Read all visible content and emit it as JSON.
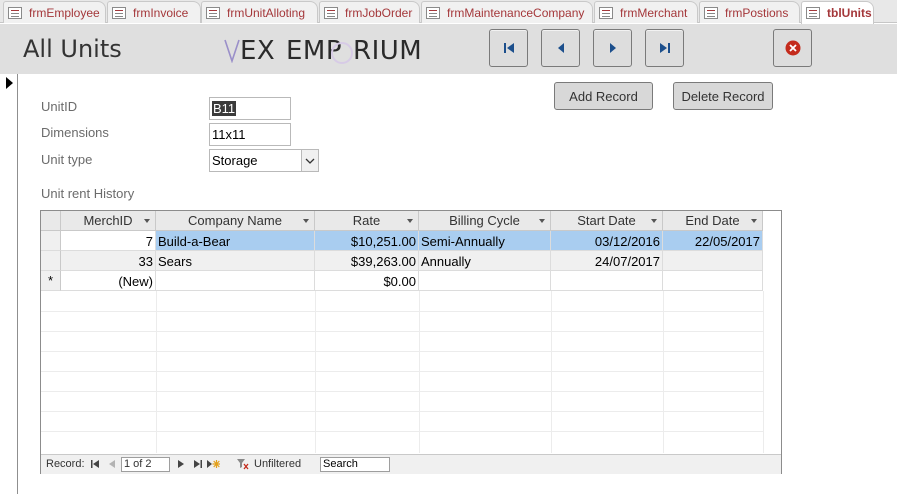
{
  "tabs": [
    {
      "label": "frmEmployee",
      "active": false
    },
    {
      "label": "frmInvoice",
      "active": false
    },
    {
      "label": "frmUnitAlloting",
      "active": false
    },
    {
      "label": "frmJobOrder",
      "active": false
    },
    {
      "label": "frmMaintenanceCompany",
      "active": false
    },
    {
      "label": "frmMerchant",
      "active": false
    },
    {
      "label": "frmPostions",
      "active": false
    },
    {
      "label": "tblUnits",
      "active": true
    }
  ],
  "header": {
    "title": "All Units",
    "logo": {
      "part1": "EX",
      "part2": "EMP",
      "part3": "RIUM"
    }
  },
  "nav_buttons": {
    "first": "first-record-icon",
    "previous": "previous-record-icon",
    "next": "next-record-icon",
    "last": "last-record-icon",
    "close": "close-icon"
  },
  "buttons": {
    "add_record": "Add Record",
    "delete_record": "Delete Record"
  },
  "fields": {
    "unitid": {
      "label": "UnitID",
      "value": "B11"
    },
    "dimensions": {
      "label": "Dimensions",
      "value": "11x11"
    },
    "unit_type": {
      "label": "Unit type",
      "value": "Storage"
    }
  },
  "subform": {
    "label": "Unit rent History",
    "columns": [
      "MerchID",
      "Company Name",
      "Rate",
      "Billing Cycle",
      "Start Date",
      "End Date"
    ],
    "rows": [
      {
        "merch_id": "7",
        "company": "Build-a-Bear",
        "rate": "$10,251.00",
        "billing": "Semi-Annually",
        "start": "03/12/2016",
        "end": "22/05/2017"
      },
      {
        "merch_id": "33",
        "company": "Sears",
        "rate": "$39,263.00",
        "billing": "Annually",
        "start": "24/07/2017",
        "end": ""
      }
    ],
    "new_row": {
      "marker": "*",
      "merch_id": "(New)",
      "rate": "$0.00"
    },
    "navigation": {
      "record_label": "Record:",
      "position": "1 of 2",
      "filter": "Unfiltered",
      "search": "Search"
    }
  },
  "colors": {
    "tab_text": "#a4373a",
    "header_bg": "#dfdfdf",
    "selected_row": "#a9cdf0",
    "nav_arrow": "#1c4f8c",
    "close_red": "#c42b1c"
  }
}
